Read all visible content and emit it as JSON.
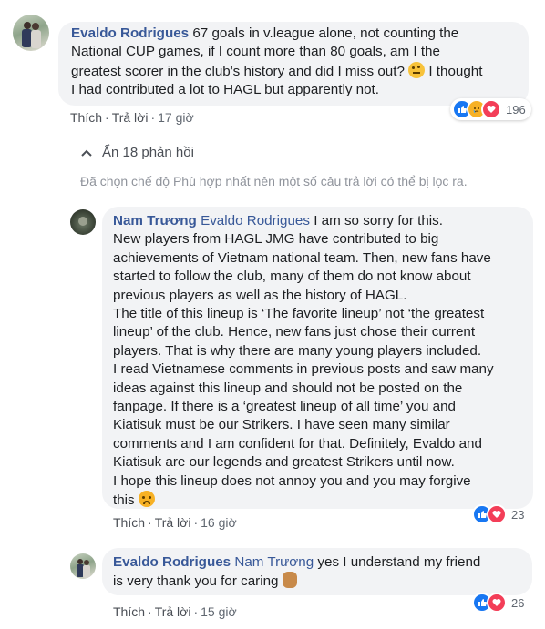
{
  "comment1": {
    "author": "Evaldo Rodrigues",
    "text1": "67 goals in v.league alone, not counting the",
    "text2": "National CUP games, if I count more than 80 goals, am I the",
    "text3": "greatest scorer in the club's history and did I miss out?",
    "text3b": "I thought",
    "text4": "I had contributed a lot to HAGL but apparently not.",
    "like": "Thích",
    "reply": "Trả lời",
    "time": "17 giờ",
    "reactions": "196"
  },
  "replies_toggle": {
    "label": "Ẩn 18 phản hồi"
  },
  "filter_notice": "Đã chọn chế độ Phù hợp nhất nên một số câu trả lời có thể bị lọc ra.",
  "comment2": {
    "author": "Nam Trương",
    "mention": "Evaldo Rodrigues",
    "first": "I am so sorry for this.",
    "lines": [
      "New players from HAGL JMG have contributed to big",
      "achievements of Vietnam national team. Then, new fans have",
      "started to follow the club, many of them do not know about",
      "previous players as well as the history of HAGL.",
      "The title of this lineup is ‘The favorite lineup’ not ‘the greatest",
      "lineup’ of the club. Hence, new fans just chose their current",
      "players. That is why there are many young players included.",
      "I read Vietnamese comments in previous posts and saw many",
      "ideas against this lineup and should not be posted on the",
      "fanpage. If there is a ‘greatest lineup of all time’ you and",
      "Kiatisuk must be our Strikers. I have seen many similar",
      "comments and I am confident for that. Definitely, Evaldo and",
      "Kiatisuk are our legends and greatest Strikers until now.",
      "I hope this lineup does not annoy you and you may forgive"
    ],
    "last": "this",
    "like": "Thích",
    "reply": "Trả lời",
    "time": "16 giờ",
    "reactions": "23"
  },
  "comment3": {
    "author": "Evaldo Rodrigues",
    "mention": "Nam Trương",
    "text1": "yes I understand my friend",
    "text2": "is very thank you for caring",
    "like": "Thích",
    "reply": "Trả lời",
    "time": "15 giờ",
    "reactions": "26"
  },
  "colors": {
    "link": "#385898",
    "bubble": "#f2f3f5",
    "like": "#1877f2",
    "love": "#f33e58",
    "haha": "#f7b125"
  }
}
